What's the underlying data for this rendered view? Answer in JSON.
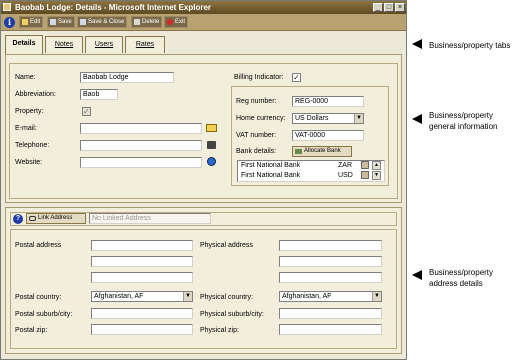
{
  "window": {
    "title": "Baobab Lodge: Details - Microsoft Internet Explorer",
    "controls": [
      "_",
      "□",
      "×"
    ]
  },
  "toolbar": {
    "buttons": [
      {
        "label": "Edit",
        "icon": "pencil-icon"
      },
      {
        "label": "Save",
        "icon": "disk-icon"
      },
      {
        "label": "Save & Close",
        "icon": "disk-icon"
      },
      {
        "label": "Delete",
        "icon": "trash-icon"
      },
      {
        "label": "Exit",
        "icon": "exit-icon"
      }
    ]
  },
  "tabs": [
    {
      "label": "Details",
      "active": true
    },
    {
      "label": "Notes",
      "active": false
    },
    {
      "label": "Users",
      "active": false
    },
    {
      "label": "Rates",
      "active": false
    }
  ],
  "general": {
    "name_label": "Name:",
    "name_value": "Baobab Lodge",
    "abbr_label": "Abbreviation:",
    "abbr_value": "Baob",
    "property_label": "Property:",
    "property_checked": true,
    "email_label": "E-mail:",
    "email_value": "",
    "telephone_label": "Telephone:",
    "telephone_value": "",
    "website_label": "Website:",
    "website_value": "",
    "billing_label": "Billing Indicator:",
    "billing_checked": true,
    "reg_label": "Reg number:",
    "reg_value": "REG-0000",
    "currency_label": "Home currency:",
    "currency_value": "US Dollars",
    "vat_label": "VAT number:",
    "vat_value": "VAT-0000",
    "bank_label": "Bank details:",
    "allocate_label": "Allocate Bank",
    "banks": [
      {
        "name": "First National Bank",
        "currency": "ZAR"
      },
      {
        "name": "First National Bank",
        "currency": "USD"
      }
    ]
  },
  "address": {
    "link_label": "Link Address",
    "linked_placeholder": "No Linked Address",
    "postal_address_label": "Postal address",
    "physical_address_label": "Physical address",
    "postal_country_label": "Postal country:",
    "postal_country_value": "Afghanistan, AF",
    "physical_country_label": "Physical country:",
    "physical_country_value": "Afghanistan, AF",
    "postal_suburb_label": "Postal suburb/city:",
    "physical_suburb_label": "Physical suburb/city:",
    "postal_zip_label": "Postal zip:",
    "physical_zip_label": "Physical zip:"
  },
  "annotations": [
    {
      "text": "Business/property tabs"
    },
    {
      "text": "Business/property general information"
    },
    {
      "text": "Business/property address details"
    }
  ],
  "colors": {
    "titlebar": "#6e5a30",
    "toolbar": "#b8a272",
    "panel": "#F2EEDC",
    "frame": "#ECE9D8"
  }
}
